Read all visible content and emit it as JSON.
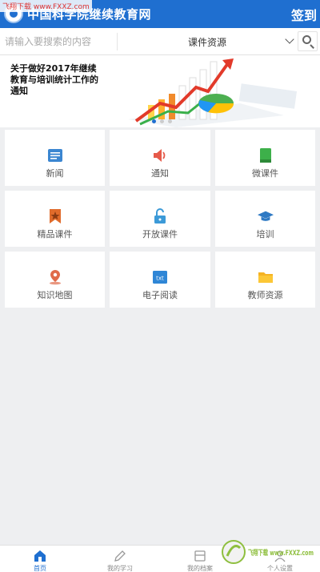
{
  "header": {
    "title": "中国科学院继续教育网",
    "signin_label": "签到",
    "watermark_top": "飞翔下载 www.FXXZ.com"
  },
  "search": {
    "placeholder": "请输入要搜索的内容",
    "category": "课件资源"
  },
  "banner": {
    "headline": "关于做好2017年继续教育与培训统计工作的通知"
  },
  "grid": [
    {
      "label": "新闻",
      "icon": "news-icon",
      "color": "#3b86d1"
    },
    {
      "label": "通知",
      "icon": "speaker-icon",
      "color": "#e65a4a"
    },
    {
      "label": "微课件",
      "icon": "book-icon",
      "color": "#3db04a"
    },
    {
      "label": "精品课件",
      "icon": "star-ribbon-icon",
      "color": "#e06b2b"
    },
    {
      "label": "开放课件",
      "icon": "unlock-icon",
      "color": "#3c9ad8"
    },
    {
      "label": "培训",
      "icon": "graduation-cap-icon",
      "color": "#2f7ac4"
    },
    {
      "label": "知识地图",
      "icon": "map-pin-icon",
      "color": "#e06b4a"
    },
    {
      "label": "电子阅读",
      "icon": "txt-file-icon",
      "color": "#2f86d6"
    },
    {
      "label": "教师资源",
      "icon": "folder-icon",
      "color": "#f5b323"
    }
  ],
  "bottom_nav": [
    {
      "label": "首页",
      "icon": "home-icon",
      "active": true
    },
    {
      "label": "我的学习",
      "icon": "pen-icon",
      "active": false
    },
    {
      "label": "我的档案",
      "icon": "archive-icon",
      "active": false
    },
    {
      "label": "个人设置",
      "icon": "user-settings-icon",
      "active": false
    }
  ],
  "watermark_bottom": "飞翔下载 www.FXXZ.com"
}
